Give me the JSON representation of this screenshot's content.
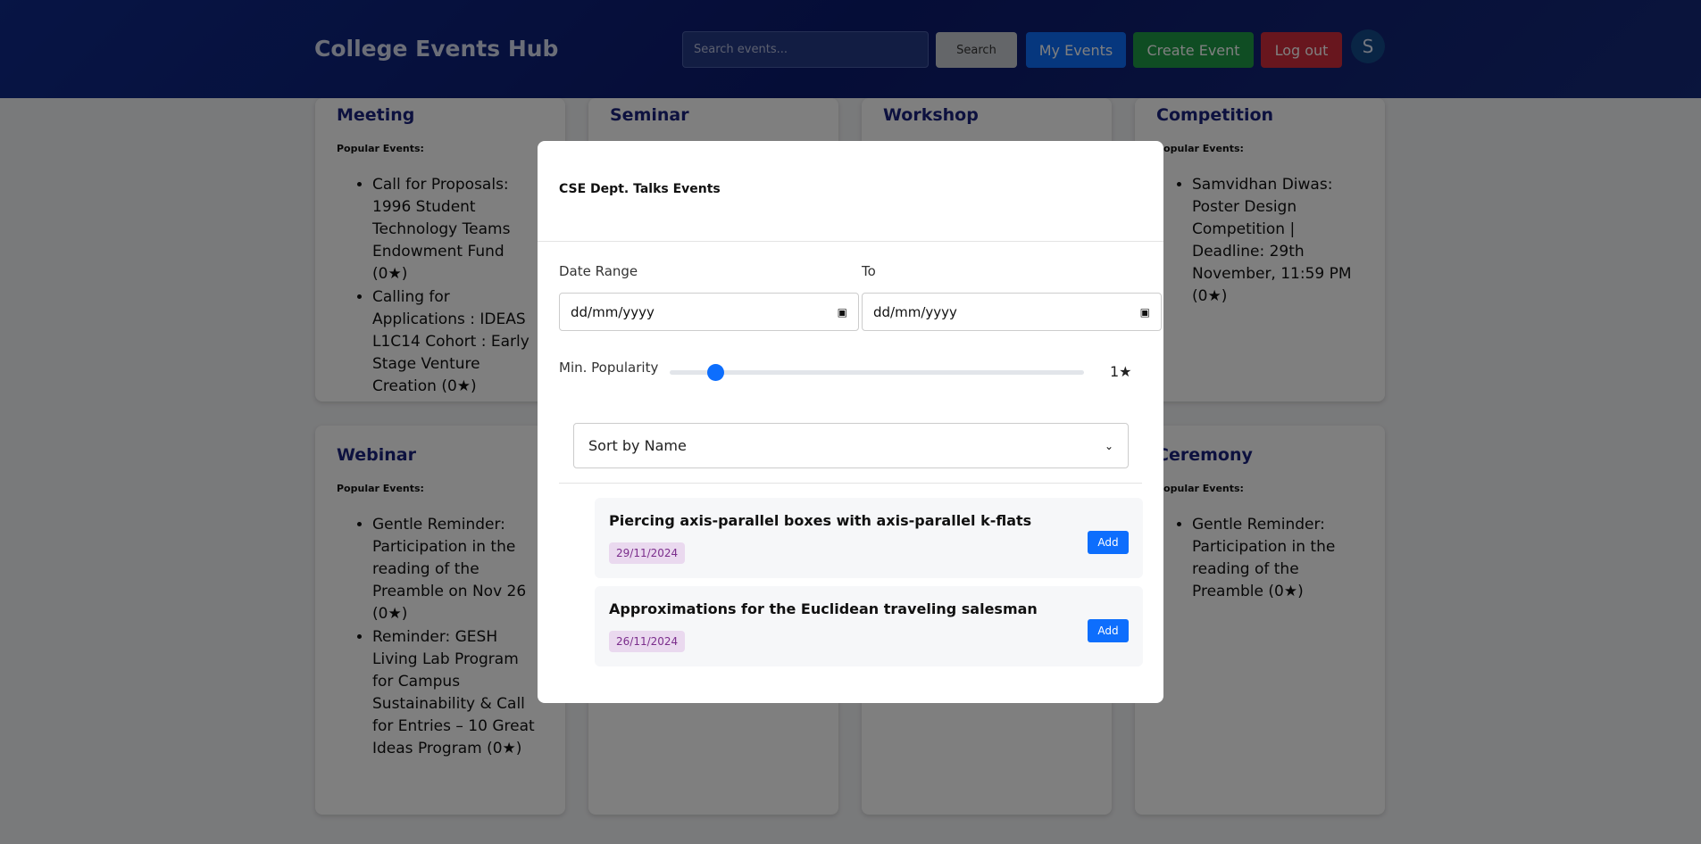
{
  "header": {
    "brand": "College Events Hub",
    "search_placeholder": "Search events...",
    "search_button": "Search",
    "my_events": "My Events",
    "create_event": "Create Event",
    "logout": "Log out",
    "avatar_initial": "S"
  },
  "categories": [
    {
      "title": "Meeting",
      "subtitle": "Popular Events:",
      "events": [
        "Call for Proposals: 1996 Student Technology Teams Endowment Fund (0★)",
        "Calling for Applications : IDEAS L1C14 Cohort : Early Stage Venture Creation (0★)"
      ]
    },
    {
      "title": "Seminar"
    },
    {
      "title": "Workshop"
    },
    {
      "title": "Competition",
      "subtitle": "Popular Events:",
      "events": [
        "Samvidhan Diwas: Poster Design Competition | Deadline: 29th November, 11:59 PM (0★)"
      ]
    },
    {
      "title": "Webinar",
      "subtitle": "Popular Events:",
      "events": [
        "Gentle Reminder: Participation in the reading of the Preamble on Nov 26 (0★)",
        "Reminder: GESH Living Lab Program for Campus Sustainability & Call for Entries – 10 Great Ideas Program (0★)"
      ]
    },
    {
      "title": "Ceremony",
      "subtitle": "Popular Events:",
      "events": [
        "Gentle Reminder: Participation in the reading of the Preamble (0★)"
      ]
    }
  ],
  "modal": {
    "title": "CSE Dept. Talks Events",
    "date_range_label": "Date Range",
    "to_label": "To",
    "date_placeholder_from": "dd/mm/yyyy",
    "date_placeholder_to": "dd/mm/yyyy",
    "popularity_label": "Min. Popularity",
    "popularity_value": 1,
    "popularity_display": "1★",
    "sort_value": "Sort by Name",
    "events": [
      {
        "title": "Piercing axis-parallel boxes with axis-parallel k-flats",
        "date": "29/11/2024",
        "action": "Add"
      },
      {
        "title": "Approximations for the Euclidean traveling salesman",
        "date": "26/11/2024",
        "action": "Add"
      }
    ]
  }
}
